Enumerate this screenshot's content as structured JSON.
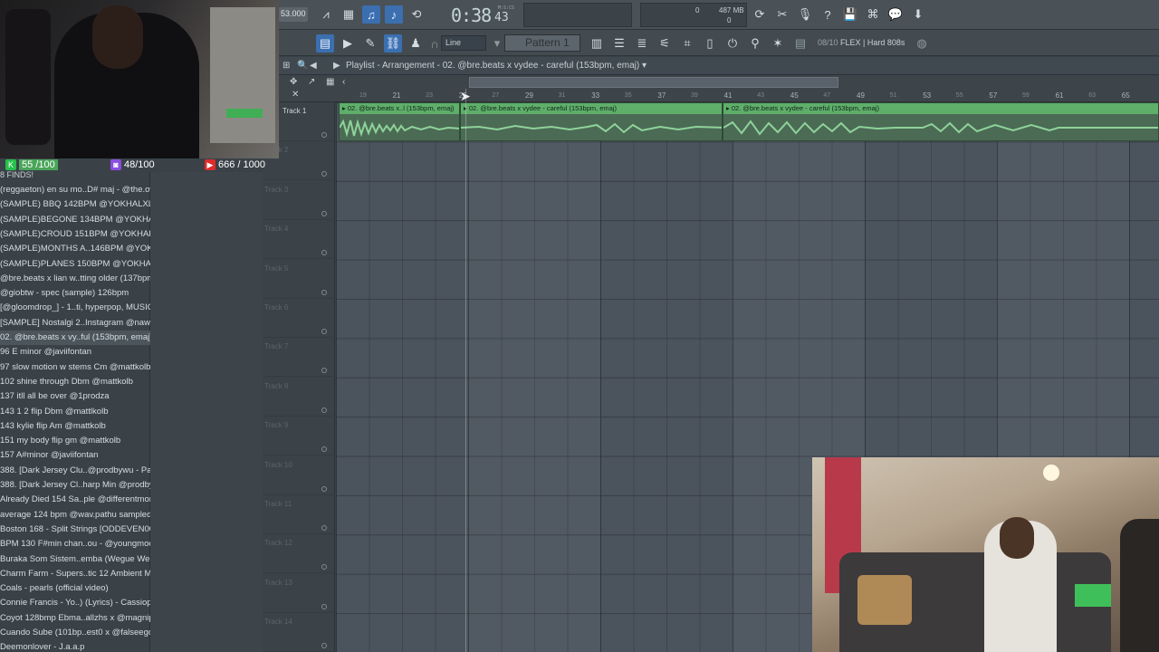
{
  "toolbar": {
    "tempo_value": "53.000",
    "time": "0:38",
    "time_sub": "43",
    "time_label": "M:S:CS",
    "memory": "487 MB",
    "mem_left": "0",
    "mem_right": "0",
    "snap": "Line",
    "pattern": "Pattern 1",
    "hint_prefix": "08/10",
    "hint": "FLEX | Hard 808s"
  },
  "playlist": {
    "title": "Playlist - Arrangement",
    "breadcrumb": "02. @bre.beats x vydee - careful (153bpm, emaj)",
    "ruler": [
      "19",
      "21",
      "23",
      "25",
      "27",
      "29",
      "31",
      "33",
      "35",
      "37",
      "39",
      "41",
      "43",
      "45",
      "47",
      "49",
      "51",
      "53",
      "55",
      "57",
      "59",
      "61",
      "63",
      "65"
    ],
    "tracks": [
      "Track 1",
      "Track 2",
      "Track 3",
      "Track 4",
      "Track 5",
      "Track 6",
      "Track 7",
      "Track 8",
      "Track 9",
      "Track 10",
      "Track 11",
      "Track 12",
      "Track 13",
      "Track 14"
    ],
    "clips": [
      {
        "label": "02. @bre.beats x..l (153bpm, emaj)"
      },
      {
        "label": "02. @bre.beats x vydee - careful (153bpm, emaj)"
      },
      {
        "label": "02. @bre.beats x vydee - careful (153bpm, emaj)"
      }
    ]
  },
  "stream": {
    "stat1": "55 /100",
    "stat2": "48/100",
    "stat3": "666 / 1000"
  },
  "browser": {
    "header": "8 FINDS!",
    "items": [
      "(reggaeton) en su mo..D# maj - @the.ownr",
      "(SAMPLE) BBQ 142BPM @YOKHALXL",
      "(SAMPLE)BEGONE 134BPM @YOKHALXL",
      "(SAMPLE)CROUD 151BPM @YOKHALXL",
      "(SAMPLE)MONTHS A..146BPM @YOKHALXL",
      "(SAMPLE)PLANES 150BPM @YOKHALXL",
      "@bre.beats x lian w..tting older (137bpm)",
      "@giobtw - spec (sample) 126bpm",
      "[@gloomdrop_] - 1..ti, hyperpop, MUSIC]",
      "[SAMPLE] Nostalgi 2..Instagram @nawijasz",
      "02. @bre.beats x vy..ful (153bpm, emaj)",
      "96 E minor @javiifontan",
      "97 slow motion w stems Cm @mattkolb ★",
      "102 shine through Dbm @mattkolb",
      "137 itll all be over @1prodza",
      "143 1 2 flip Dbm @mattlkolb",
      "143 kylie flip Am @mattkolb",
      "151 my body flip gm @mattkolb",
      "157 A#minor @javiifontan",
      "388. [Dark Jersey Clu..@prodbywu - Part_1",
      "388. [Dark Jersey Cl..harp Min @prodbywu",
      "Already Died 154 Sa..ple @differentmoney",
      "average 124 bpm @wav.pathu sampled",
      "Boston 168 - Split Strings [ODDEVEN004]",
      "BPM 130 F#min chan..ou - @youngmooskii",
      "Buraka Som Sistem..emba (Wegue Wegue)",
      "Charm Farm - Supers..tic 12 Ambient Mix)",
      "Coals - pearls (official video)",
      "Connie Francis - Yo..) (Lyrics) - Cassiopeia",
      "Coyot 128bmp Ebma..allzhs x @magniprod",
      "Cuando Sube (101bp..est0 x @falseego333",
      "Deemonlover - J.a.a.p"
    ]
  },
  "colors": {
    "accent": "#3b6fb0",
    "clip_header": "#5fae6a",
    "clip_body": "#4b6b55",
    "grid": "#4b535d"
  }
}
